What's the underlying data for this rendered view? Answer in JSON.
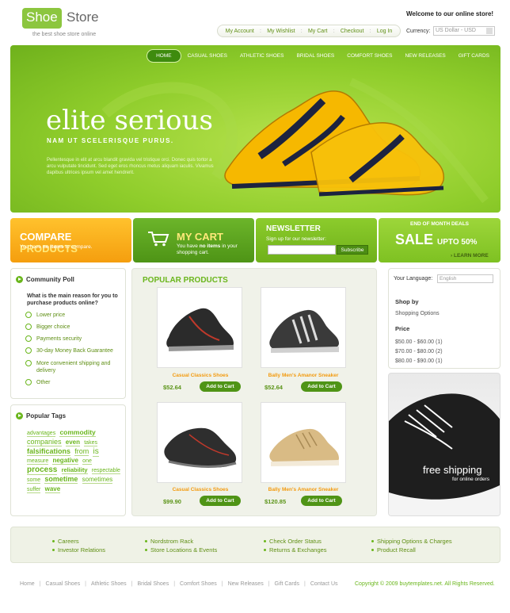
{
  "header": {
    "logo_shoe": "Shoe",
    "logo_store": "Store",
    "tagline": "the best shoe store online",
    "welcome": "Welcome to our online store!",
    "top_links": [
      "My Account",
      "My Wishlist",
      "My Cart",
      "Checkout",
      "Log In"
    ],
    "currency_label": "Currency:",
    "currency_value": "US Dollar - USD"
  },
  "nav": {
    "items": [
      "HOME",
      "CASUAL SHOES",
      "ATHLETIC SHOES",
      "BRIDAL SHOES",
      "COMFORT SHOES",
      "NEW RELEASES",
      "GIFT CARDS"
    ]
  },
  "banner": {
    "title": "elite serious",
    "subtitle": "NAM UT SCELERISQUE PURUS.",
    "text": "Pellentesque in elit at arcu blandit gravida vel tristique orci. Donec quis tortor a arcu vulputate tincidunt. Sed eget eros rhoncus metus aliquam iaculis. Vivamus dapibus ultrices ipsum vel amet hendrerit."
  },
  "promos": {
    "compare_prefix": "COMPARE",
    "compare_main": "PRODUCTS",
    "compare_sub_pre": "You have ",
    "compare_sub_bold": "no items",
    "compare_sub_post": " to compare.",
    "cart_prefix": "MY",
    "cart_main": "CART",
    "cart_sub_pre": "You have ",
    "cart_sub_bold": "no items",
    "cart_sub_post": " in your shopping cart.",
    "news_title": "NEWSLETTER",
    "news_sub": "Sign up for our newsletter:",
    "news_button": "Subscribe",
    "sale_head": "END OF MONTH DEALS",
    "sale_main": "SALE",
    "sale_small": "UPTO 50%",
    "sale_more": "LEARN MORE"
  },
  "poll": {
    "title": "Community Poll",
    "question": "What is the main reason for you to purchase products online?",
    "options": [
      "Lower price",
      "Bigger choice",
      "Payments security",
      "30-day Money Back Guarantee",
      "More convenient shipping and delivery",
      "Other"
    ]
  },
  "tags": {
    "title": "Popular Tags",
    "items": [
      "advantages",
      "commodity",
      "companies",
      "even",
      "takes",
      "falsifications",
      "from",
      "is",
      "measure",
      "negative",
      "one",
      "process",
      "reliability",
      "respectable",
      "some",
      "sometime",
      "sometimes",
      "suffer",
      "wave"
    ]
  },
  "popular": {
    "title": "POPULAR PRODUCTS",
    "button": "Add to Cart",
    "products": [
      {
        "name": "Casual Classics Shoes",
        "price": "$52.64"
      },
      {
        "name": "Bally Men's Amanor Sneaker",
        "price": "$52.64"
      },
      {
        "name": "Casual Classics Shoes",
        "price": "$99.90"
      },
      {
        "name": "Bally Men's Amanor Sneaker",
        "price": "$120.85"
      }
    ]
  },
  "right": {
    "lang_label": "Your Language:",
    "lang_value": "English",
    "shop_by": "Shop by",
    "shop_options": "Shopping Options",
    "price_head": "Price",
    "prices": [
      "$50.00 - $60.00 (1)",
      "$70.00 - $80.00 (2)",
      "$80.00 - $90.00 (1)"
    ],
    "free_title": "free shipping",
    "free_sub": "for online orders"
  },
  "footer": {
    "col1": [
      "Careers",
      "Investor Relations"
    ],
    "col2": [
      "Nordstrom Rack",
      "Store Locations & Events"
    ],
    "col3": [
      "Check Order Status",
      "Returns & Exchanges"
    ],
    "col4": [
      "Shipping Options & Charges",
      "Product Recall"
    ],
    "bottom_nav": [
      "Home",
      "Casual Shoes",
      "Athletic Shoes",
      "Bridal Shoes",
      "Comfort Shoes",
      "New Releases",
      "Gift Cards",
      "Contact Us"
    ],
    "copyright": "Copyright © 2009 buytemplates.net. All Rights Reserved."
  }
}
